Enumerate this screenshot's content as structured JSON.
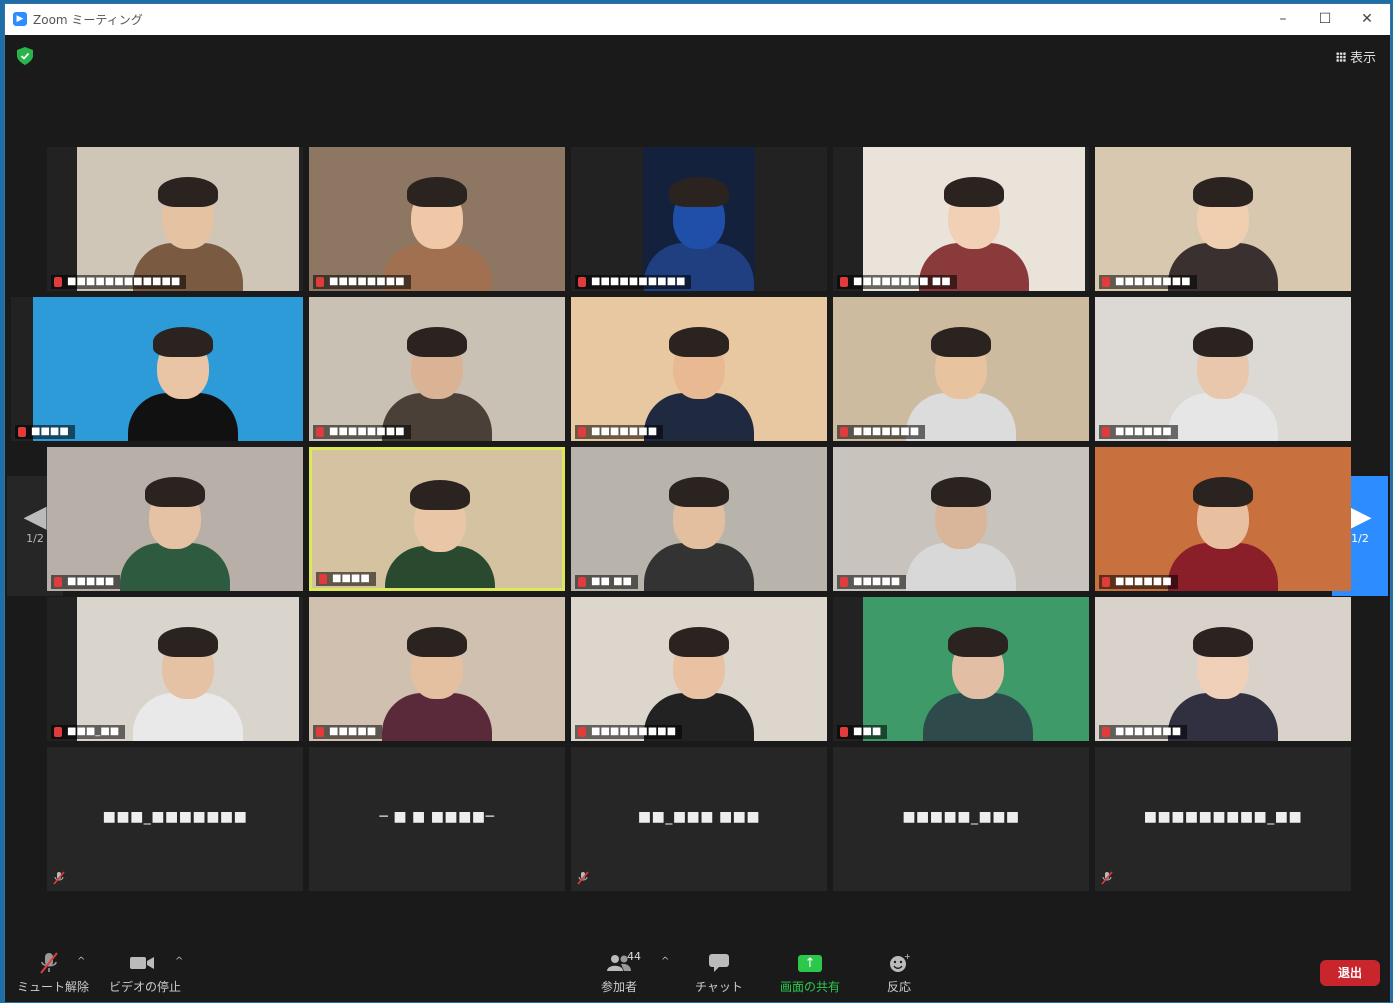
{
  "window": {
    "title": "Zoom ミーティング",
    "controls": [
      "–",
      "☐",
      "✕"
    ]
  },
  "header": {
    "view_label": "表示",
    "security_icon": "shield-check-icon"
  },
  "pager": {
    "left_page": "1/2",
    "right_page": "1/2"
  },
  "audio_participants": [
    {
      "name": "■■■_■■■■■■■"
    },
    {
      "name": "─ ■ ■ ■■■■─"
    },
    {
      "name": "■■_■■■ ■■■"
    },
    {
      "name": "■■■■■_■■■"
    },
    {
      "name": "■■■■■■■■■_■■"
    }
  ],
  "video_tiles": [
    {
      "name": "■■■■■■■■■■■■"
    },
    {
      "name": "■■■■■■■■"
    },
    {
      "name": "■■■■■■■■■■"
    },
    {
      "name": "■■■■■■■■ ■■"
    },
    {
      "name": "■■■■■■■■"
    },
    {
      "name": "■■■■"
    },
    {
      "name": "■■■■■■■■"
    },
    {
      "name": "■■■■■■■"
    },
    {
      "name": "■■■■■■■"
    },
    {
      "name": "■■■■■■"
    },
    {
      "name": "■■■■■"
    },
    {
      "name": "■■■■"
    },
    {
      "name": "■■ ■■"
    },
    {
      "name": "■■■■■"
    },
    {
      "name": "■■■■■■"
    },
    {
      "name": "■■■_■■"
    },
    {
      "name": "■■■■■"
    },
    {
      "name": "■■■■■■■■■"
    },
    {
      "name": "■■■"
    },
    {
      "name": "■■■■■■■"
    }
  ],
  "toolbar": {
    "mute": {
      "label": "ミュート解除",
      "icon": "microphone-muted-icon"
    },
    "video": {
      "label": "ビデオの停止",
      "icon": "video-camera-icon"
    },
    "participants": {
      "label": "参加者",
      "count": "44",
      "icon": "participants-icon"
    },
    "chat": {
      "label": "チャット",
      "icon": "chat-bubble-icon"
    },
    "share": {
      "label": "画面の共有",
      "icon": "share-screen-icon",
      "color": "#2cc84a"
    },
    "reactions": {
      "label": "反応",
      "icon": "emoji-add-icon"
    },
    "leave": {
      "label": "退出",
      "color": "#c9252d"
    }
  }
}
